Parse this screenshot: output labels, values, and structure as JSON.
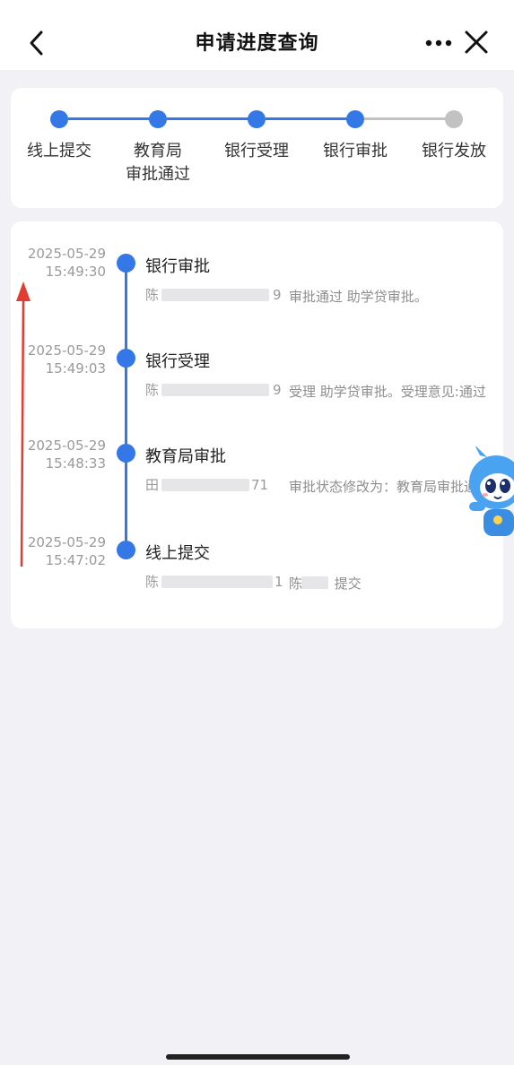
{
  "header": {
    "title": "申请进度查询",
    "back_icon": "chevron-left-icon",
    "more_icon": "more-dots-icon",
    "close_icon": "close-icon"
  },
  "colors": {
    "accent": "#3478e8",
    "pending": "#c2c2c2",
    "background": "#f2f2f6",
    "arrow": "#e23d33"
  },
  "stepper": {
    "steps": [
      {
        "line1": "线上提交",
        "line2": "",
        "status": "done"
      },
      {
        "line1": "教育局",
        "line2": "审批通过",
        "status": "done"
      },
      {
        "line1": "银行受理",
        "line2": "",
        "status": "done"
      },
      {
        "line1": "银行审批",
        "line2": "",
        "status": "done"
      },
      {
        "line1": "银行发放",
        "line2": "",
        "status": "pending"
      }
    ]
  },
  "timeline": {
    "items": [
      {
        "date": "2025-05-29",
        "time": "15:49:30",
        "title": "银行审批",
        "person_prefix": "陈",
        "person_suffix": "9",
        "desc": "审批通过 助学贷审批。"
      },
      {
        "date": "2025-05-29",
        "time": "15:49:03",
        "title": "银行受理",
        "person_prefix": "陈",
        "person_suffix": "9",
        "desc": "受理 助学贷审批。受理意见:通过"
      },
      {
        "date": "2025-05-29",
        "time": "15:48:33",
        "title": "教育局审批",
        "person_prefix": "田",
        "person_suffix": "71",
        "desc": "审批状态修改为：教育局审批通过"
      },
      {
        "date": "2025-05-29",
        "time": "15:47:02",
        "title": "线上提交",
        "person_prefix": "陈",
        "person_suffix": "1",
        "desc_prefix": "陈",
        "desc": "提交"
      }
    ]
  },
  "mascot_icon": "blue-robot-mascot-icon"
}
